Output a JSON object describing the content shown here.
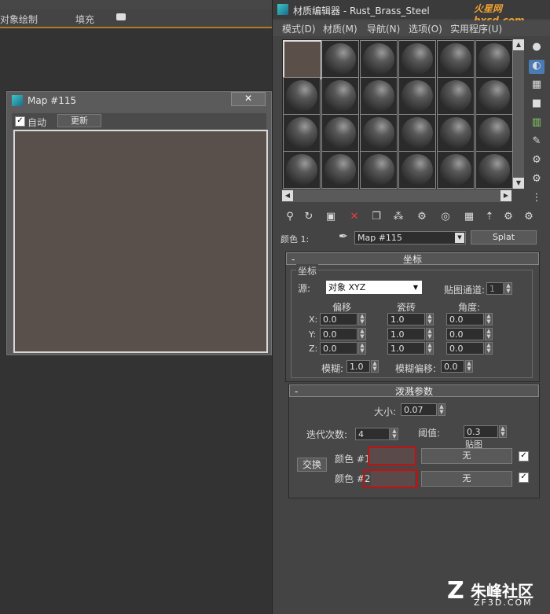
{
  "host": {
    "ribbon_object_paint": "对象绘制",
    "ribbon_fill": "填充"
  },
  "map_window": {
    "title": "Map #115",
    "close_symbol": "✕",
    "auto_label": "自动",
    "auto_checked": true,
    "update_button": "更新"
  },
  "material_editor": {
    "title": "材质编辑器 - Rust_Brass_Steel",
    "menu": [
      "模式(D)",
      "材质(M)",
      "导航(N)",
      "选项(O)",
      "实用程序(U)"
    ],
    "color1_label": "颜色 1:",
    "map_name": "Map #115",
    "map_type_button": "Splat",
    "coords": {
      "header": "坐标",
      "group": "坐标",
      "source_label": "源:",
      "source_value": "对象 XYZ",
      "map_channel_label": "贴图通道:",
      "map_channel_value": "1",
      "col_offset": "偏移",
      "col_tiling": "瓷砖",
      "col_angle": "角度:",
      "rows": [
        {
          "axis": "X:",
          "offset": "0.0",
          "tiling": "1.0",
          "angle": "0.0"
        },
        {
          "axis": "Y:",
          "offset": "0.0",
          "tiling": "1.0",
          "angle": "0.0"
        },
        {
          "axis": "Z:",
          "offset": "0.0",
          "tiling": "1.0",
          "angle": "0.0"
        }
      ],
      "blur_label": "模糊:",
      "blur_value": "1.0",
      "blur_offset_label": "模糊偏移:",
      "blur_offset_value": "0.0"
    },
    "splat": {
      "header": "泼溅参数",
      "size_label": "大小:",
      "size_value": "0.07",
      "iterations_label": "迭代次数:",
      "iterations_value": "4",
      "threshold_label": "阈值:",
      "threshold_value": "0.3",
      "maps_label": "贴图",
      "swap_button": "交换",
      "color1_label": "颜色 #1",
      "color2_label": "颜色 #2",
      "map1_button": "无",
      "map2_button": "无",
      "map1_checked": true,
      "map2_checked": true
    }
  },
  "watermarks": {
    "top": "火星网 hxsd.com",
    "bottom_cn": "朱峰社区",
    "bottom_en": "ZF3D.COM"
  },
  "colors": {
    "swatch_color": "#5a4a4a",
    "highlight_red": "#c61010",
    "preview_brown": "#5a504b"
  }
}
